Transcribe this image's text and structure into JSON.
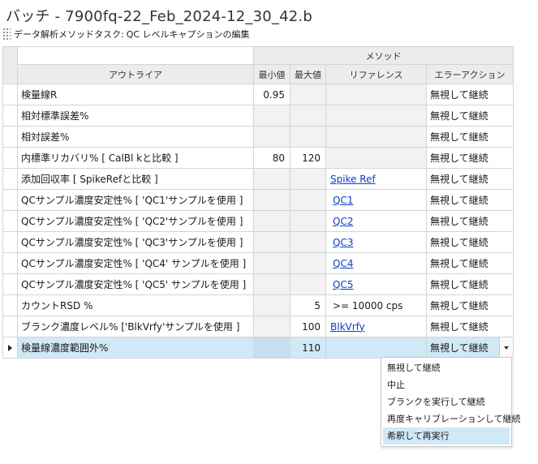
{
  "window": {
    "title": "バッチ - 7900fq-22_Feb_2024-12_30_42.b"
  },
  "task": {
    "label": "データ解析メソッドタスク:",
    "value": "QC レベルキャプションの編集"
  },
  "table": {
    "group_header": "メソッド",
    "columns": {
      "outlier": "アウトライア",
      "min": "最小値",
      "max": "最大値",
      "reference": "リファレンス",
      "action": "エラーアクション"
    },
    "rows": [
      {
        "outlier": "検量線R",
        "min": "0.95",
        "max": "",
        "reference": "",
        "action": "無視して継続"
      },
      {
        "outlier": "相対標準誤差%",
        "min": "",
        "max": "",
        "reference": "",
        "action": "無視して継続"
      },
      {
        "outlier": "相対誤差%",
        "min": "",
        "max": "",
        "reference": "",
        "action": "無視して継続"
      },
      {
        "outlier": "内標準リカバリ%  [ CalBl kと比較 ]",
        "min": "80",
        "max": "120",
        "reference": "",
        "action": "無視して継続"
      },
      {
        "outlier": "添加回収率  [ SpikeRefと比較 ]",
        "min": "",
        "max": "",
        "reference": "Spike Ref",
        "action": "無視して継続"
      },
      {
        "outlier": "QCサンプル濃度安定性%  [ 'QC1'サンプルを使用 ]",
        "min": "",
        "max": "",
        "reference": "QC1",
        "action": "無視して継続"
      },
      {
        "outlier": "QCサンプル濃度安定性%  [ 'QC2'サンプルを使用 ]",
        "min": "",
        "max": "",
        "reference": "QC2",
        "action": "無視して継続"
      },
      {
        "outlier": "QCサンプル濃度安定性%  [ 'QC3'サンプルを使用 ]",
        "min": "",
        "max": "",
        "reference": "QC3",
        "action": "無視して継続"
      },
      {
        "outlier": "QCサンプル濃度安定性%  [ 'QC4' サンプルを使用 ]",
        "min": "",
        "max": "",
        "reference": "QC4",
        "action": "無視して継続"
      },
      {
        "outlier": "QCサンプル濃度安定性%  [ 'QC5' サンプルを使用 ]",
        "min": "",
        "max": "",
        "reference": "QC5",
        "action": "無視して継続"
      },
      {
        "outlier": "カウントRSD %",
        "min": "",
        "max": "5",
        "reference": ">= 10000 cps",
        "action": "無視して継続"
      },
      {
        "outlier": "ブランク濃度レベル%  ['BlkVrfy'サンプルを使用 ]",
        "min": "",
        "max": "100",
        "reference": "BlkVrfy",
        "action": "無視して継続"
      },
      {
        "outlier": "検量線濃度範囲外%",
        "min": "",
        "max": "110",
        "reference": "",
        "action": "無視して継続"
      }
    ]
  },
  "dropdown": {
    "options": [
      "無視して継続",
      "中止",
      "ブランクを実行して継続",
      "再度キャリブレーションして継続",
      "希釈して再実行"
    ],
    "highlighted": "希釈して再実行"
  }
}
